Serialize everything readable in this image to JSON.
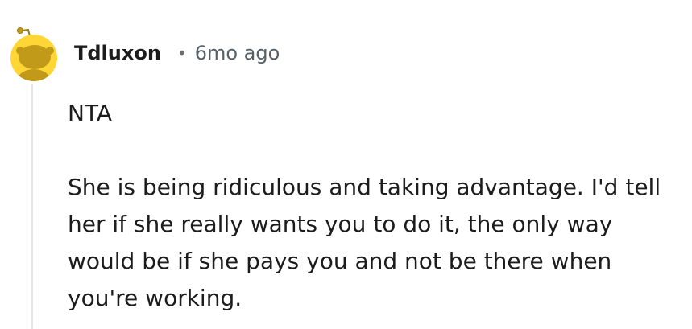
{
  "comment": {
    "author": "Tdluxon",
    "separator": "•",
    "time": "6mo ago",
    "paragraphs": [
      "NTA",
      "She is being ridiculous and taking advantage. I'd tell her if she really wants you to do it, the only way would be if she pays you and not be there when you're working."
    ]
  },
  "avatar": {
    "icon": "snoo-avatar-icon",
    "background_color": "#FFD635",
    "figure_color": "#C19A1A"
  }
}
